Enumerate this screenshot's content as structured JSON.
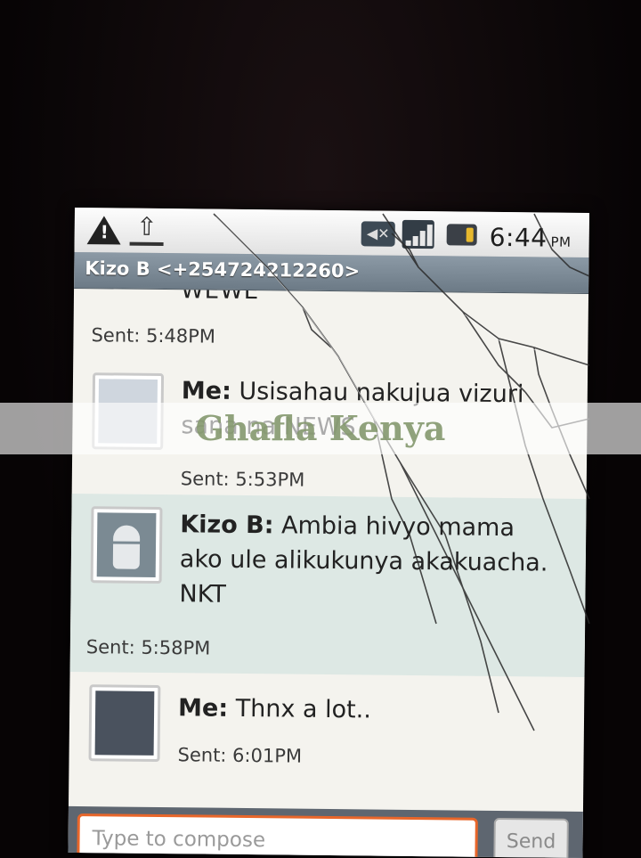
{
  "status_bar": {
    "time": "6:44",
    "ampm": "PM"
  },
  "conversation": {
    "title": "Kizo B <+254724212260>",
    "cutoff_text": "WEWE",
    "first_sent": "Sent: 5:48PM",
    "messages": [
      {
        "sender": "Me:",
        "text": "Usisahau nakujua vizuri sana na NEWS",
        "sent": "Sent: 5:53PM"
      },
      {
        "sender": "Kizo B:",
        "text": "Ambia hivyo mama ako ule alikukunya akakuacha. NKT",
        "sent": "Sent: 5:58PM"
      },
      {
        "sender": "Me:",
        "text": "Thnx a lot..",
        "sent": "Sent: 6:01PM"
      }
    ]
  },
  "compose": {
    "placeholder": "Type to compose",
    "send_label": "Send"
  },
  "watermark": "Ghafla Kenya",
  "colors": {
    "title_bar": "#7c8a96",
    "compose_border": "#e8662a",
    "battery": "#e7b82d"
  }
}
